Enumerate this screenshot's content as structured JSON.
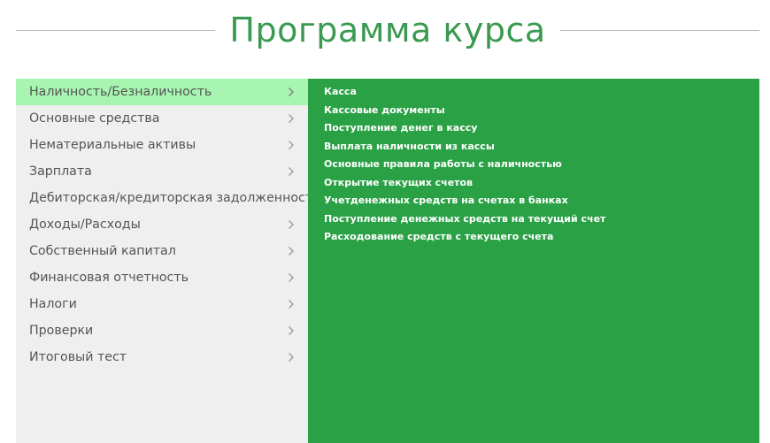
{
  "header": {
    "title": "Программа курса"
  },
  "sidebar": {
    "items": [
      {
        "label": "Наличность/Безналичность",
        "active": true
      },
      {
        "label": "Основные средства",
        "active": false
      },
      {
        "label": "Нематериальные активы",
        "active": false
      },
      {
        "label": "Зарплата",
        "active": false
      },
      {
        "label": "Дебиторская/кредиторская задолженность",
        "active": false
      },
      {
        "label": "Доходы/Расходы",
        "active": false
      },
      {
        "label": "Собственный капитал",
        "active": false
      },
      {
        "label": "Финансовая отчетность",
        "active": false
      },
      {
        "label": "Налоги",
        "active": false
      },
      {
        "label": "Проверки",
        "active": false
      },
      {
        "label": "Итоговый тест",
        "active": false
      }
    ]
  },
  "content": {
    "topics": [
      "Касса",
      "Кассовые документы",
      "Поступление денег в кассу",
      "Выплата наличности из кассы",
      "Основные правила работы с наличностью",
      "Открытие текущих счетов",
      "Учетденежных средств на счетах в банках",
      "Поступление денежных средств на текущий счет",
      "Расходование средств с текущего счета"
    ]
  },
  "colors": {
    "title": "#3a9a50",
    "active_item_bg": "#a8f5b2",
    "sidebar_bg": "#efefef",
    "content_bg": "#2ba146",
    "topic_text": "#ffffff"
  },
  "icons": {
    "item_chevron": "chevron-right-icon"
  }
}
